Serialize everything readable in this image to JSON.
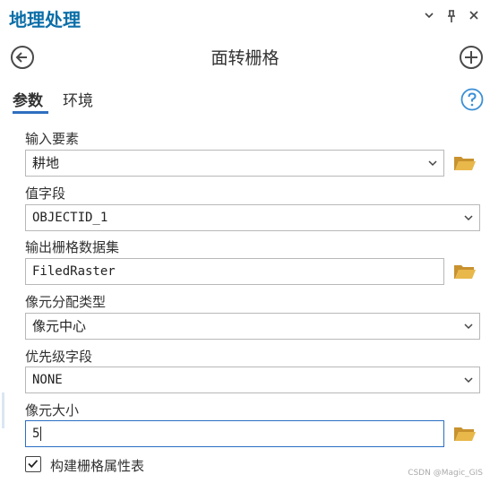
{
  "pane": {
    "title": "地理处理"
  },
  "window_controls": {
    "dropdown_glyph": "⌄",
    "pin_glyph": "⊥",
    "close_glyph": "✕"
  },
  "tool": {
    "title": "面转栅格"
  },
  "tabs": [
    {
      "label": "参数",
      "active": true
    },
    {
      "label": "环境",
      "active": false
    }
  ],
  "params": {
    "input_features": {
      "label": "输入要素",
      "value": "耕地"
    },
    "value_field": {
      "label": "值字段",
      "value": "OBJECTID_1"
    },
    "output_raster": {
      "label": "输出栅格数据集",
      "value": "FiledRaster"
    },
    "cell_assignment": {
      "label": "像元分配类型",
      "value": "像元中心"
    },
    "priority_field": {
      "label": "优先级字段",
      "value": "NONE"
    },
    "cell_size": {
      "label": "像元大小",
      "value": "5"
    },
    "build_attribute_table": {
      "label": "构建栅格属性表",
      "checked": true
    }
  },
  "watermark": "CSDN @Magic_GIS",
  "colors": {
    "accent": "#0b6ea8",
    "tab_underline": "#2f6fbf",
    "folder": "#e2b24a",
    "help": "#3a8fd6"
  }
}
